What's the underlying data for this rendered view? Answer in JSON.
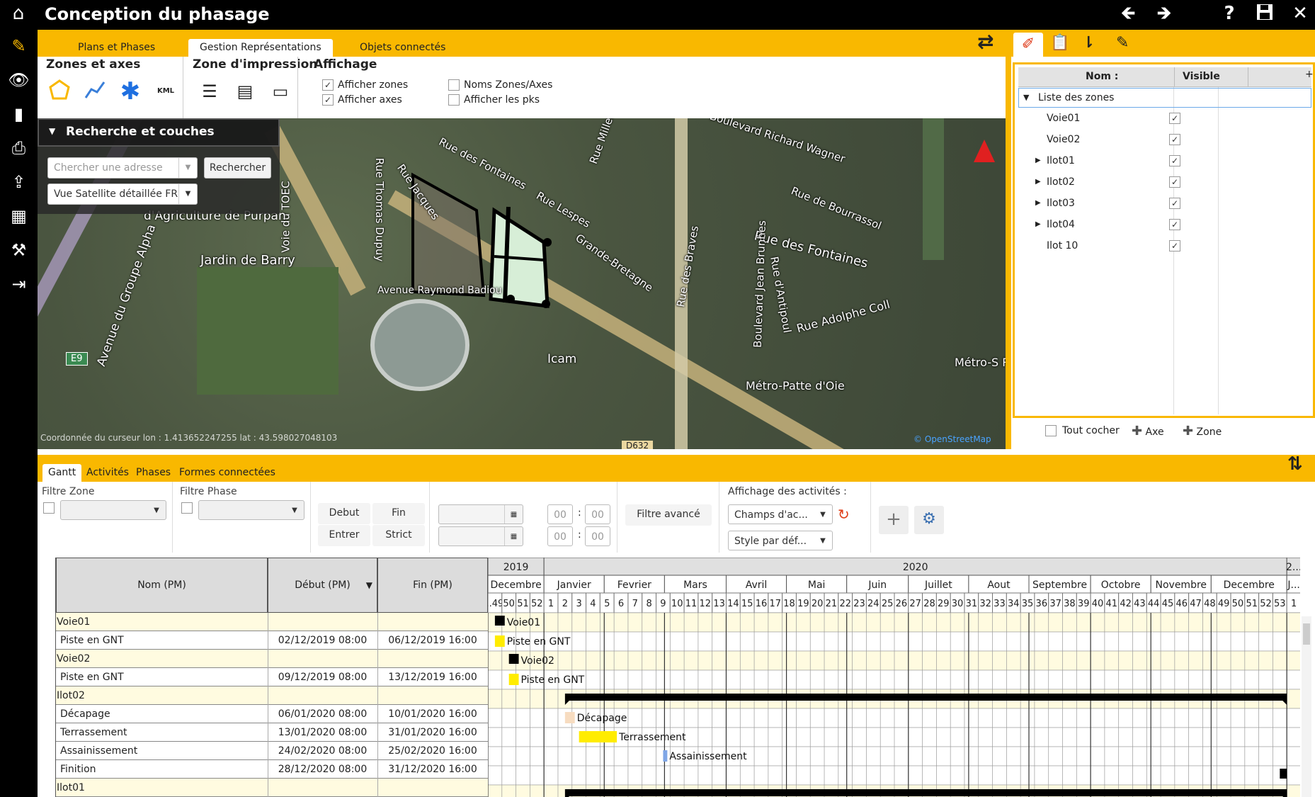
{
  "app": {
    "title": "Conception du phasage"
  },
  "tabs": [
    "Plans et Phases",
    "Gestion Représentations",
    "Objets connectés"
  ],
  "ribbon": {
    "zones_title": "Zones et axes",
    "zones_kml": "KML",
    "print_title": "Zone d'impression",
    "display_title": "Affichage",
    "checks": [
      {
        "label": "Afficher zones",
        "checked": true
      },
      {
        "label": "Afficher axes",
        "checked": true
      },
      {
        "label": "Noms Zones/Axes",
        "checked": false
      },
      {
        "label": "Afficher les pks",
        "checked": false
      }
    ]
  },
  "search": {
    "title": "Recherche et couches",
    "placeholder": "Chercher une adresse",
    "button": "Rechercher",
    "layer": "Vue Satellite détaillée FR"
  },
  "map": {
    "labels": [
      "Boulevard Richard Wagner",
      "Rue de Bourrassol",
      "Rue des Fontaines",
      "Rue des Fontaines",
      "Rue Lespes",
      "Rue Jacques",
      "Rue Thomas Dupuy",
      "Voie du TOEC",
      "Avenue Raymond Badiou",
      "Jardin de Barry",
      "d'Agriculture de Purpan",
      "Avenue du Groupe Alpha",
      "Grande-Bretagne",
      "Rue des Braves",
      "Boulevard Jean Brunhes",
      "Rue d'Antipoul",
      "Rue Adolphe Coll",
      "Icam",
      "Métro-Patte d'Oie",
      "Métro-S Rép",
      "E9",
      "D632",
      "Rue Millet"
    ],
    "coords_text": "Coordonnée du curseur lon : 1.413652247255 lat : 43.598027048103",
    "attribution": "© OpenStreetMap"
  },
  "zones_panel": {
    "col_name": "Nom :",
    "col_visible": "Visible",
    "root": "Liste des zones",
    "items": [
      {
        "name": "Voie01",
        "expandable": false,
        "visible": true
      },
      {
        "name": "Voie02",
        "expandable": false,
        "visible": true
      },
      {
        "name": "Ilot01",
        "expandable": true,
        "visible": true
      },
      {
        "name": "Ilot02",
        "expandable": true,
        "visible": true
      },
      {
        "name": "Ilot03",
        "expandable": true,
        "visible": true
      },
      {
        "name": "Ilot04",
        "expandable": true,
        "visible": true
      },
      {
        "name": "Ilot 10",
        "expandable": false,
        "visible": true
      }
    ],
    "tout_cocher": "Tout cocher",
    "add_axe": "Axe",
    "add_zone": "Zone"
  },
  "gantt_tabs": [
    "Gantt",
    "Activités",
    "Phases",
    "Formes connectées"
  ],
  "filters": {
    "zone": "Filtre Zone",
    "phase": "Filtre Phase",
    "debut": "Debut",
    "fin": "Fin",
    "entrer": "Entrer",
    "strict": "Strict",
    "time1h": "00",
    "time1m": "00",
    "time2h": "00",
    "time2m": "00",
    "avance": "Filtre avancé",
    "affichage_label": "Affichage des activités :",
    "champs": "Champs d'ac...",
    "style": "Style par déf..."
  },
  "gantt": {
    "col_nom": "Nom (PM)",
    "col_debut": "Début (PM)",
    "col_fin": "Fin (PM)",
    "years": [
      {
        "label": "2019"
      },
      {
        "label": "2020"
      },
      {
        "label": "2..."
      }
    ],
    "months": [
      "Decembre",
      "Janvier",
      "Fevrier",
      "Mars",
      "Avril",
      "Mai",
      "Juin",
      "Juillet",
      "Aout",
      "Septembre",
      "Octobre",
      "Novembre",
      "Decembre",
      "J..."
    ],
    "weeks": [
      "..49",
      "50",
      "51",
      "52",
      "1",
      "2",
      "3",
      "4",
      "5",
      "6",
      "7",
      "8",
      "9",
      "10",
      "11",
      "12",
      "13",
      "14",
      "15",
      "16",
      "17",
      "18",
      "19",
      "20",
      "21",
      "22",
      "23",
      "24",
      "25",
      "26",
      "27",
      "28",
      "29",
      "30",
      "31",
      "32",
      "33",
      "34",
      "35",
      "36",
      "37",
      "38",
      "39",
      "40",
      "41",
      "42",
      "43",
      "44",
      "45",
      "46",
      "47",
      "48",
      "49",
      "50",
      "51",
      "52",
      "53",
      "1"
    ],
    "rows": [
      {
        "nom": "Voie01",
        "debut": "",
        "fin": "",
        "group": true,
        "bar_label": "Voie01",
        "bar_start_week": 0.5,
        "bar_weeks": 0.7,
        "bar_kind": "milestone"
      },
      {
        "nom": "Piste en GNT",
        "debut": "02/12/2019 08:00",
        "fin": "06/12/2019 16:00",
        "group": false,
        "bar_label": "Piste en GNT",
        "bar_start_week": 0.5,
        "bar_weeks": 0.7,
        "bar_kind": "yellow"
      },
      {
        "nom": "Voie02",
        "debut": "",
        "fin": "",
        "group": true,
        "bar_label": "Voie02",
        "bar_start_week": 1.5,
        "bar_weeks": 0.7,
        "bar_kind": "milestone"
      },
      {
        "nom": "Piste en GNT",
        "debut": "09/12/2019 08:00",
        "fin": "13/12/2019 16:00",
        "group": false,
        "bar_label": "Piste en GNT",
        "bar_start_week": 1.5,
        "bar_weeks": 0.7,
        "bar_kind": "yellow"
      },
      {
        "nom": "Ilot02",
        "debut": "",
        "fin": "",
        "group": true,
        "bar_label": "",
        "bar_start_week": 5.5,
        "bar_weeks": 51.5,
        "bar_kind": "summary"
      },
      {
        "nom": "Décapage",
        "debut": "06/01/2020 08:00",
        "fin": "10/01/2020 16:00",
        "group": false,
        "bar_label": "Décapage",
        "bar_start_week": 5.5,
        "bar_weeks": 0.7,
        "bar_kind": "beige"
      },
      {
        "nom": "Terrassement",
        "debut": "13/01/2020 08:00",
        "fin": "31/01/2020 16:00",
        "group": false,
        "bar_label": "Terrassement",
        "bar_start_week": 6.5,
        "bar_weeks": 2.7,
        "bar_kind": "yellow"
      },
      {
        "nom": "Assainissement",
        "debut": "24/02/2020 08:00",
        "fin": "25/02/2020 16:00",
        "group": false,
        "bar_label": "Assainissement",
        "bar_start_week": 12.5,
        "bar_weeks": 0.3,
        "bar_kind": "blue"
      },
      {
        "nom": "Finition",
        "debut": "28/12/2020 08:00",
        "fin": "31/12/2020 16:00",
        "group": false,
        "bar_label": "",
        "bar_start_week": 56.5,
        "bar_weeks": 0.5,
        "bar_kind": "milestone"
      },
      {
        "nom": "Ilot01",
        "debut": "",
        "fin": "",
        "group": true,
        "bar_label": "",
        "bar_start_week": 5.5,
        "bar_weeks": 51.5,
        "bar_kind": "summary"
      }
    ]
  }
}
